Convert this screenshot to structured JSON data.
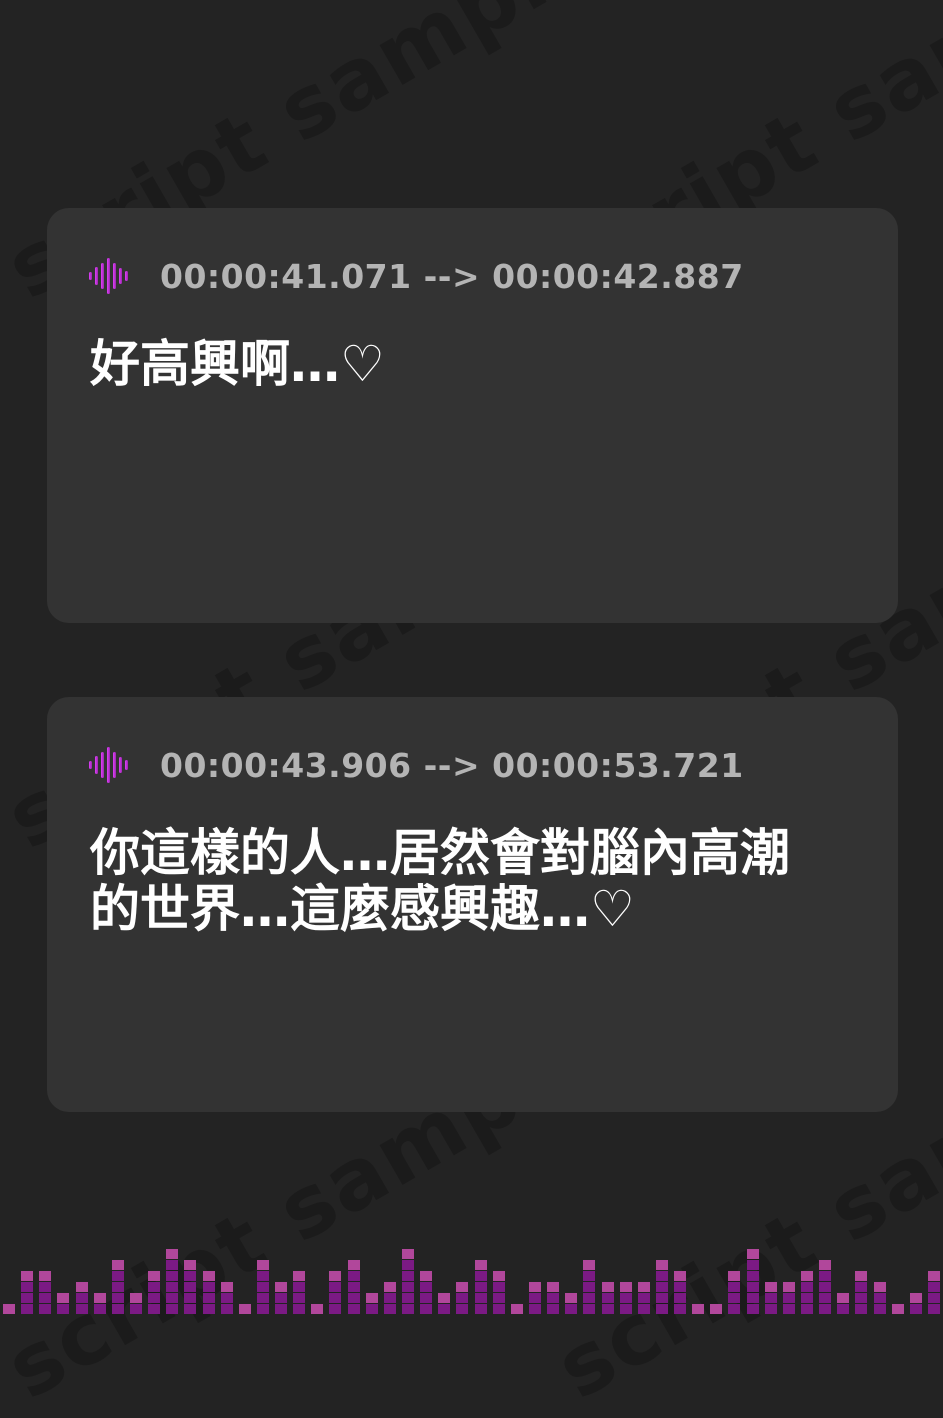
{
  "watermark": "script sample",
  "accent": {
    "wave_from": "#e040fb",
    "wave_to": "#9c27b0",
    "eq_bright": "#b1479b",
    "eq_dark": "#7b1a84"
  },
  "cards": [
    {
      "icon": "sound-wave-icon",
      "timestamp": "00:00:41.071 --> 00:00:42.887",
      "line1": "好高興啊…♡",
      "line2": ""
    },
    {
      "icon": "sound-wave-icon",
      "timestamp": "00:00:43.906 --> 00:00:53.721",
      "line1": "你這樣的人…居然會對腦內高潮",
      "line2": "的世界…這麼感興趣…♡"
    }
  ],
  "equalizer": {
    "icon": "audio-equalizer-icon",
    "levels": [
      1,
      4,
      4,
      2,
      3,
      2,
      5,
      2,
      4,
      6,
      5,
      4,
      3,
      1,
      5,
      3,
      4,
      1,
      4,
      5,
      2,
      3,
      6,
      4,
      2,
      3,
      5,
      4,
      1,
      3,
      3,
      2,
      5,
      3,
      3,
      3,
      5,
      4,
      1,
      1,
      4,
      6,
      3,
      3,
      4,
      5,
      2,
      4,
      3,
      1,
      2,
      4
    ]
  }
}
